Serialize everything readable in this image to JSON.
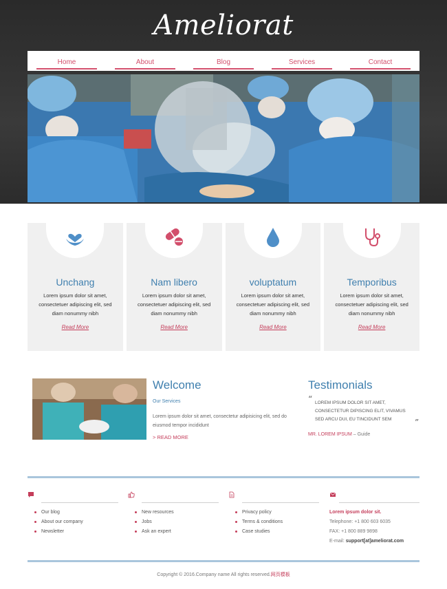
{
  "header": {
    "logo": "Ameliorat"
  },
  "nav": {
    "items": [
      "Home",
      "About",
      "Blog",
      "Services",
      "Contact"
    ]
  },
  "features": [
    {
      "title": "Unchang",
      "text": "Lorem ipsum dolor sit amet, consectetuer adipiscing elit, sed diam nonummy nibh",
      "link": "Read More",
      "icon": "hands-heart-icon",
      "color": "#4f8fc8"
    },
    {
      "title": "Nam libero",
      "text": "Lorem ipsum dolor sit amet, consectetuer adipiscing elit, sed diam nonummy nibh",
      "link": "Read More",
      "icon": "pills-icon",
      "color": "#d24e6b"
    },
    {
      "title": "voluptatum",
      "text": "Lorem ipsum dolor sit amet, consectetuer adipiscing elit, sed diam nonummy nibh",
      "link": "Read More",
      "icon": "drop-icon",
      "color": "#4f8fc8"
    },
    {
      "title": "Temporibus",
      "text": "Lorem ipsum dolor sit amet, consectetuer adipiscing elit, sed diam nonummy nibh",
      "link": "Read More",
      "icon": "stethoscope-icon",
      "color": "#d24e6b"
    }
  ],
  "welcome": {
    "title": "Welcome",
    "subtitle": "Our Services",
    "text": "Lorem ipsum dolor sit amet, consectetur adipisicing elit, sed do eiusmod tempor incididunt",
    "more": "> READ MORE"
  },
  "testimonials": {
    "title": "Testimonials",
    "quote": "LOREM IPSUM DOLOR SIT AMET, CONSECTETUR DIPISCING ELIT, VIVAMUS SED ARCU DUI, EU TINCIDUNT SEM",
    "author": "MR. LOREM IPSUM",
    "role": "– Guide"
  },
  "footer": {
    "col1": {
      "icon": "comment-icon",
      "items": [
        "Our blog",
        "About our company",
        "Newsletter"
      ]
    },
    "col2": {
      "icon": "thumbs-up-icon",
      "items": [
        "New resources",
        "Jobs",
        "Ask an expert"
      ]
    },
    "col3": {
      "icon": "document-icon",
      "items": [
        "Privacy policy",
        "Terms & conditions",
        "Case studies"
      ]
    },
    "contact": {
      "icon": "envelope-icon",
      "name": "Lorem ipsum dolor sit.",
      "phone": "Telephone: +1 800 603 6035",
      "fax": "FAX: +1 800 889 9898",
      "email_label": "E-mail:",
      "email": "support[at]ameliorat.com"
    },
    "copyright": "Copyright © 2016.Company name All rights reserved.",
    "copyright_link": "网页模板"
  },
  "colors": {
    "accent": "#d24e6b",
    "primary": "#3f7fae",
    "rule": "#a9c5dc"
  }
}
